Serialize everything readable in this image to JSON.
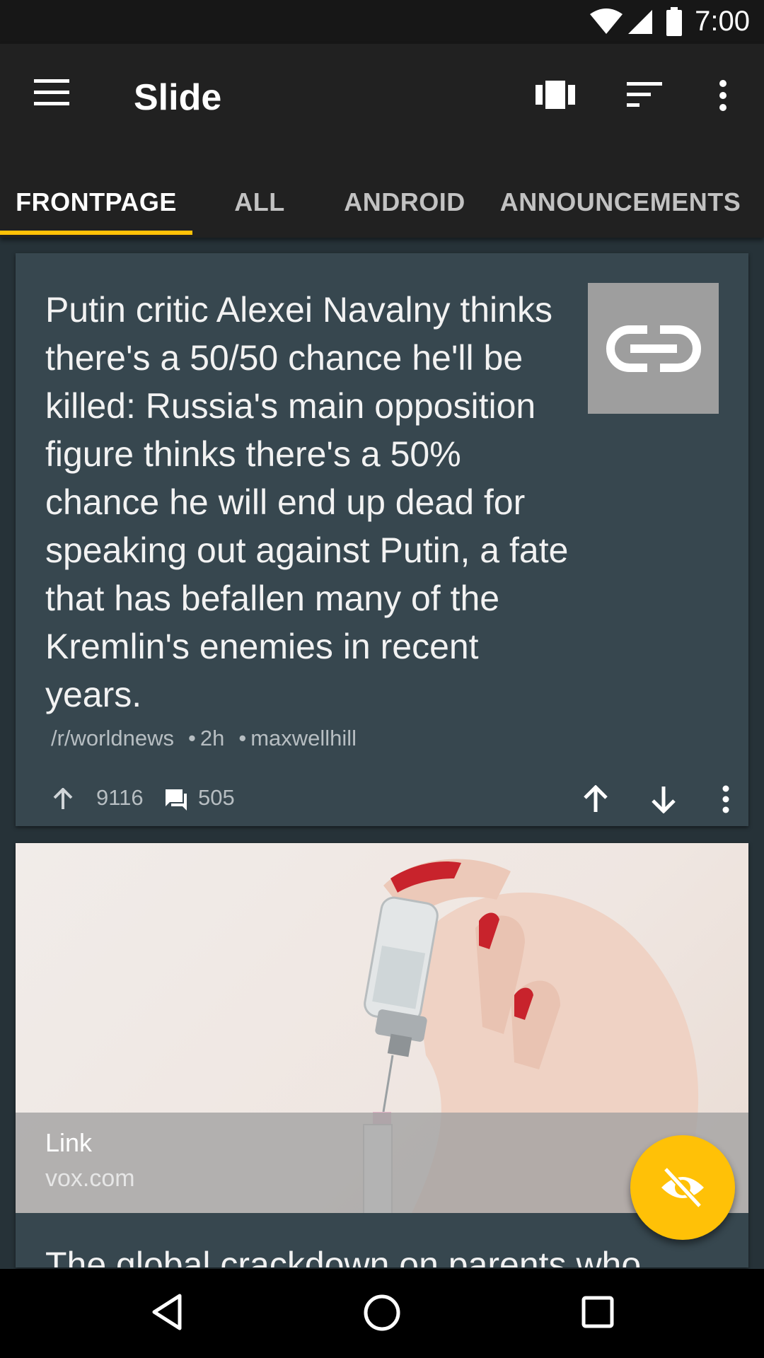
{
  "status_bar": {
    "time": "7:00"
  },
  "app_bar": {
    "title": "Slide"
  },
  "tabs": [
    {
      "label": "FRONTPAGE",
      "active": true
    },
    {
      "label": "ALL",
      "active": false
    },
    {
      "label": "ANDROID",
      "active": false
    },
    {
      "label": "ANNOUNCEMENTS",
      "active": false
    }
  ],
  "posts": [
    {
      "title": "Putin critic Alexei Navalny thinks there's a 50/50 chance he'll be killed: Russia's main opposition figure thinks there's a 50% chance he will end up dead for speaking out against Putin, a fate that has befallen many of the Kremlin's enemies in recent years.",
      "subreddit": "/r/worldnews",
      "age": "2h",
      "author": "maxwellhill",
      "score": "9116",
      "comments": "505",
      "thumbnail_icon": "link-icon"
    },
    {
      "link_type": "Link",
      "domain": "vox.com",
      "title": "The global crackdown on parents who"
    }
  ],
  "fab": {
    "icon": "hide-eye-icon"
  },
  "colors": {
    "accent": "#ffc107",
    "card": "#37474f",
    "background": "#263238",
    "toolbar": "#212121"
  }
}
